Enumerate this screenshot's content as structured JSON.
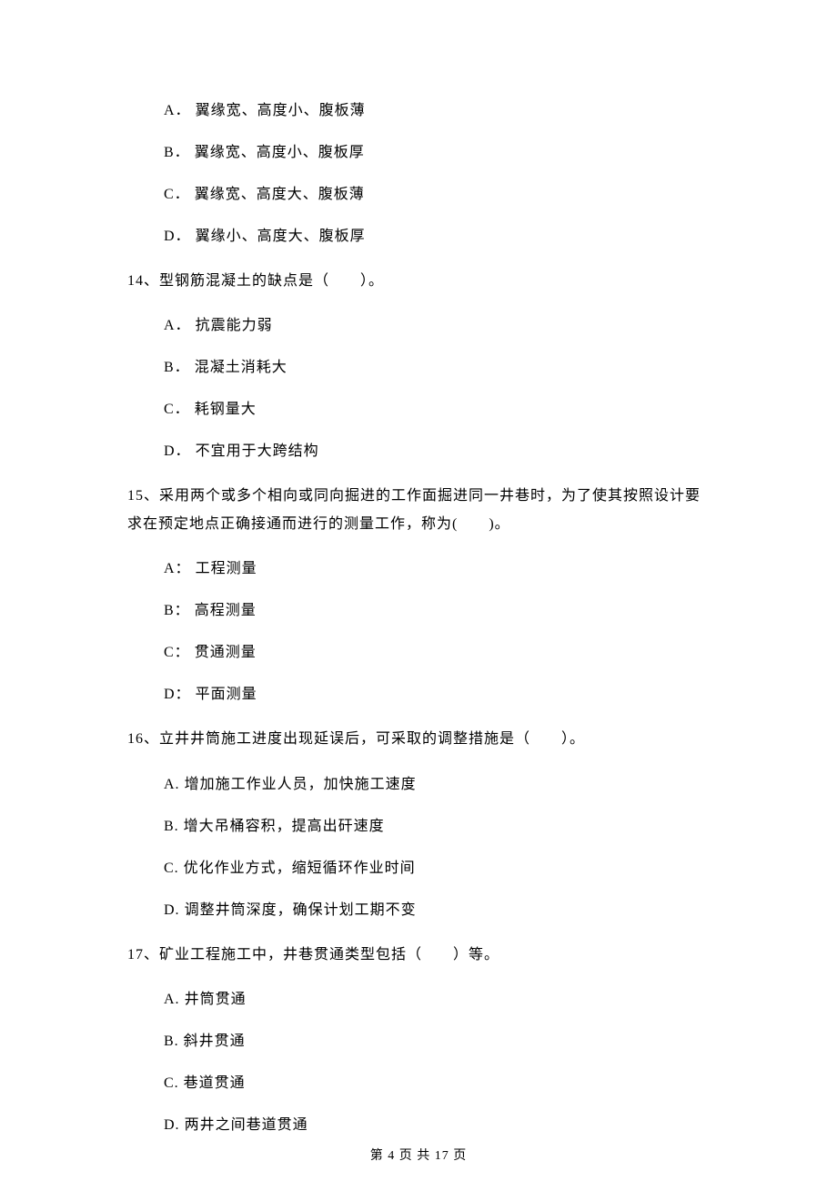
{
  "options_pre": [
    {
      "label": "A．",
      "text": "翼缘宽、高度小、腹板薄"
    },
    {
      "label": "B．",
      "text": "翼缘宽、高度小、腹板厚"
    },
    {
      "label": "C．",
      "text": "翼缘宽、高度大、腹板薄"
    },
    {
      "label": "D．",
      "text": "翼缘小、高度大、腹板厚"
    }
  ],
  "q14": {
    "stem": "14、型钢筋混凝土的缺点是（　　）。",
    "options": [
      {
        "label": "A．",
        "text": "抗震能力弱"
      },
      {
        "label": "B．",
        "text": "混凝土消耗大"
      },
      {
        "label": "C．",
        "text": "耗钢量大"
      },
      {
        "label": "D．",
        "text": "不宜用于大跨结构"
      }
    ]
  },
  "q15": {
    "stem": "15、采用两个或多个相向或同向掘进的工作面掘进同一井巷时，为了使其按照设计要求在预定地点正确接通而进行的测量工作，称为(　　)。",
    "options": [
      {
        "label": "A：",
        "text": "工程测量"
      },
      {
        "label": "B：",
        "text": "高程测量"
      },
      {
        "label": "C：",
        "text": "贯通测量"
      },
      {
        "label": "D：",
        "text": "平面测量"
      }
    ]
  },
  "q16": {
    "stem": "16、立井井筒施工进度出现延误后，可采取的调整措施是（　　）。",
    "options": [
      {
        "label": "A.",
        "text": "增加施工作业人员，加快施工速度"
      },
      {
        "label": "B.",
        "text": "增大吊桶容积，提高出矸速度"
      },
      {
        "label": "C.",
        "text": "优化作业方式，缩短循环作业时间"
      },
      {
        "label": "D.",
        "text": "调整井筒深度，确保计划工期不变"
      }
    ]
  },
  "q17": {
    "stem": "17、矿业工程施工中，井巷贯通类型包括（　　）等。",
    "options": [
      {
        "label": "A.",
        "text": "井筒贯通"
      },
      {
        "label": "B.",
        "text": "斜井贯通"
      },
      {
        "label": "C.",
        "text": "巷道贯通"
      },
      {
        "label": "D.",
        "text": "两井之间巷道贯通"
      }
    ]
  },
  "footer": "第 4 页 共 17 页"
}
